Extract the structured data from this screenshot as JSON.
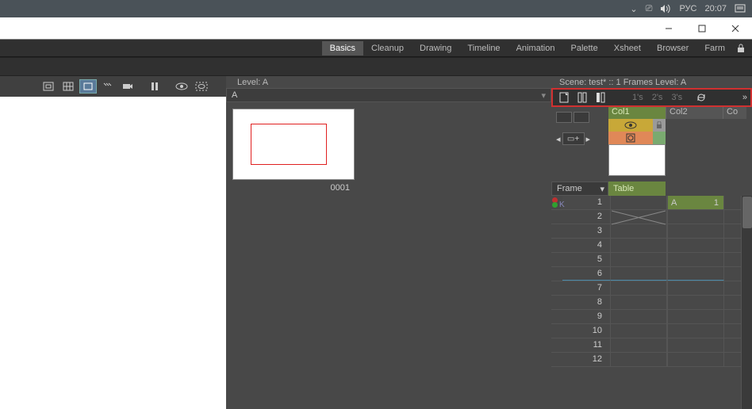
{
  "taskbar": {
    "lang": "РУС",
    "time": "20:07"
  },
  "rooms": [
    "Basics",
    "Cleanup",
    "Drawing",
    "Timeline",
    "Animation",
    "Palette",
    "Xsheet",
    "Browser",
    "Farm"
  ],
  "rooms_active": 0,
  "viewer": {
    "level_label": "Level:  A",
    "dropdown": "A",
    "thumb_label": "0001"
  },
  "xsheet": {
    "scene_label": "Scene: test*   ::   1 Frames  Level: A",
    "steps": [
      "1's",
      "2's",
      "3's"
    ],
    "cols": [
      "Col1",
      "Col2",
      "Co"
    ],
    "frame_label": "Frame",
    "table_label": "Table",
    "cell_level": "A",
    "cell_frame": "1",
    "rows": [
      1,
      2,
      3,
      4,
      5,
      6,
      7,
      8,
      9,
      10,
      11,
      12
    ]
  }
}
